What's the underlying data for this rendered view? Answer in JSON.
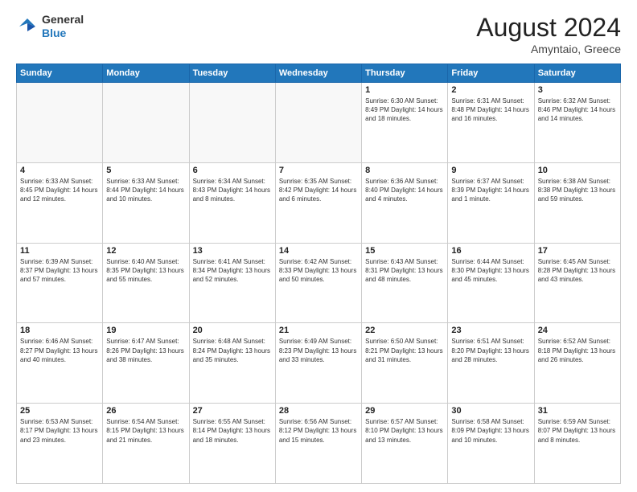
{
  "header": {
    "logo_general": "General",
    "logo_blue": "Blue",
    "title": "August 2024",
    "location": "Amyntaio, Greece"
  },
  "weekdays": [
    "Sunday",
    "Monday",
    "Tuesday",
    "Wednesday",
    "Thursday",
    "Friday",
    "Saturday"
  ],
  "weeks": [
    [
      {
        "day": "",
        "info": ""
      },
      {
        "day": "",
        "info": ""
      },
      {
        "day": "",
        "info": ""
      },
      {
        "day": "",
        "info": ""
      },
      {
        "day": "1",
        "info": "Sunrise: 6:30 AM\nSunset: 8:49 PM\nDaylight: 14 hours and 18 minutes."
      },
      {
        "day": "2",
        "info": "Sunrise: 6:31 AM\nSunset: 8:48 PM\nDaylight: 14 hours and 16 minutes."
      },
      {
        "day": "3",
        "info": "Sunrise: 6:32 AM\nSunset: 8:46 PM\nDaylight: 14 hours and 14 minutes."
      }
    ],
    [
      {
        "day": "4",
        "info": "Sunrise: 6:33 AM\nSunset: 8:45 PM\nDaylight: 14 hours and 12 minutes."
      },
      {
        "day": "5",
        "info": "Sunrise: 6:33 AM\nSunset: 8:44 PM\nDaylight: 14 hours and 10 minutes."
      },
      {
        "day": "6",
        "info": "Sunrise: 6:34 AM\nSunset: 8:43 PM\nDaylight: 14 hours and 8 minutes."
      },
      {
        "day": "7",
        "info": "Sunrise: 6:35 AM\nSunset: 8:42 PM\nDaylight: 14 hours and 6 minutes."
      },
      {
        "day": "8",
        "info": "Sunrise: 6:36 AM\nSunset: 8:40 PM\nDaylight: 14 hours and 4 minutes."
      },
      {
        "day": "9",
        "info": "Sunrise: 6:37 AM\nSunset: 8:39 PM\nDaylight: 14 hours and 1 minute."
      },
      {
        "day": "10",
        "info": "Sunrise: 6:38 AM\nSunset: 8:38 PM\nDaylight: 13 hours and 59 minutes."
      }
    ],
    [
      {
        "day": "11",
        "info": "Sunrise: 6:39 AM\nSunset: 8:37 PM\nDaylight: 13 hours and 57 minutes."
      },
      {
        "day": "12",
        "info": "Sunrise: 6:40 AM\nSunset: 8:35 PM\nDaylight: 13 hours and 55 minutes."
      },
      {
        "day": "13",
        "info": "Sunrise: 6:41 AM\nSunset: 8:34 PM\nDaylight: 13 hours and 52 minutes."
      },
      {
        "day": "14",
        "info": "Sunrise: 6:42 AM\nSunset: 8:33 PM\nDaylight: 13 hours and 50 minutes."
      },
      {
        "day": "15",
        "info": "Sunrise: 6:43 AM\nSunset: 8:31 PM\nDaylight: 13 hours and 48 minutes."
      },
      {
        "day": "16",
        "info": "Sunrise: 6:44 AM\nSunset: 8:30 PM\nDaylight: 13 hours and 45 minutes."
      },
      {
        "day": "17",
        "info": "Sunrise: 6:45 AM\nSunset: 8:28 PM\nDaylight: 13 hours and 43 minutes."
      }
    ],
    [
      {
        "day": "18",
        "info": "Sunrise: 6:46 AM\nSunset: 8:27 PM\nDaylight: 13 hours and 40 minutes."
      },
      {
        "day": "19",
        "info": "Sunrise: 6:47 AM\nSunset: 8:26 PM\nDaylight: 13 hours and 38 minutes."
      },
      {
        "day": "20",
        "info": "Sunrise: 6:48 AM\nSunset: 8:24 PM\nDaylight: 13 hours and 35 minutes."
      },
      {
        "day": "21",
        "info": "Sunrise: 6:49 AM\nSunset: 8:23 PM\nDaylight: 13 hours and 33 minutes."
      },
      {
        "day": "22",
        "info": "Sunrise: 6:50 AM\nSunset: 8:21 PM\nDaylight: 13 hours and 31 minutes."
      },
      {
        "day": "23",
        "info": "Sunrise: 6:51 AM\nSunset: 8:20 PM\nDaylight: 13 hours and 28 minutes."
      },
      {
        "day": "24",
        "info": "Sunrise: 6:52 AM\nSunset: 8:18 PM\nDaylight: 13 hours and 26 minutes."
      }
    ],
    [
      {
        "day": "25",
        "info": "Sunrise: 6:53 AM\nSunset: 8:17 PM\nDaylight: 13 hours and 23 minutes."
      },
      {
        "day": "26",
        "info": "Sunrise: 6:54 AM\nSunset: 8:15 PM\nDaylight: 13 hours and 21 minutes."
      },
      {
        "day": "27",
        "info": "Sunrise: 6:55 AM\nSunset: 8:14 PM\nDaylight: 13 hours and 18 minutes."
      },
      {
        "day": "28",
        "info": "Sunrise: 6:56 AM\nSunset: 8:12 PM\nDaylight: 13 hours and 15 minutes."
      },
      {
        "day": "29",
        "info": "Sunrise: 6:57 AM\nSunset: 8:10 PM\nDaylight: 13 hours and 13 minutes."
      },
      {
        "day": "30",
        "info": "Sunrise: 6:58 AM\nSunset: 8:09 PM\nDaylight: 13 hours and 10 minutes."
      },
      {
        "day": "31",
        "info": "Sunrise: 6:59 AM\nSunset: 8:07 PM\nDaylight: 13 hours and 8 minutes."
      }
    ]
  ]
}
